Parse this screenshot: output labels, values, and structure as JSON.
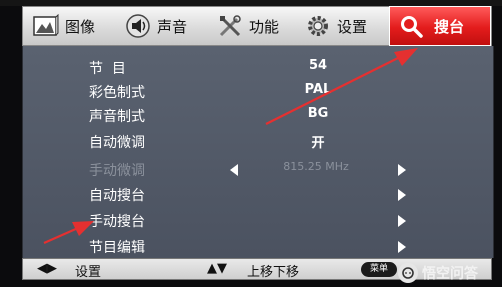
{
  "top_menu": {
    "tabs": [
      {
        "label": "图像",
        "icon": "picture-icon"
      },
      {
        "label": "声音",
        "icon": "speaker-icon"
      },
      {
        "label": "功能",
        "icon": "tools-icon"
      },
      {
        "label": "设置",
        "icon": "gear-icon"
      },
      {
        "label": "搜台",
        "icon": "search-icon",
        "selected": true
      }
    ]
  },
  "menu_items": [
    {
      "name": "节  目",
      "value": "54"
    },
    {
      "name": "彩色制式",
      "value": "PAL"
    },
    {
      "name": "声音制式",
      "value": "BG"
    },
    {
      "name": "自动微调",
      "value": "开"
    },
    {
      "name": "手动微调",
      "value": "815.25 MHz",
      "disabled": true
    },
    {
      "name": "自动搜台",
      "value": ""
    },
    {
      "name": "手动搜台",
      "value": ""
    },
    {
      "name": "节目编辑",
      "value": ""
    }
  ],
  "bottom_bar": {
    "lr_hint": "设置",
    "ud_hint": "上移下移",
    "menu_key": "菜单"
  },
  "watermark": {
    "text": "悟空问答"
  },
  "colors": {
    "selected_tab": "#e31c1c",
    "panel": "#525a68",
    "annotation_arrow": "#e53030"
  }
}
